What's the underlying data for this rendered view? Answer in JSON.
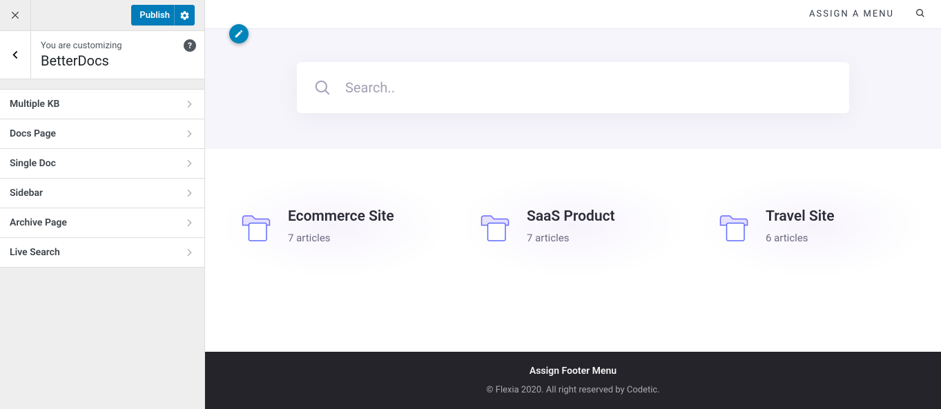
{
  "customizer": {
    "publish_label": "Publish",
    "pretitle": "You are customizing",
    "title": "BetterDocs",
    "help_symbol": "?",
    "items": [
      {
        "label": "Multiple KB"
      },
      {
        "label": "Docs Page"
      },
      {
        "label": "Single Doc"
      },
      {
        "label": "Sidebar"
      },
      {
        "label": "Archive Page"
      },
      {
        "label": "Live Search"
      }
    ]
  },
  "preview": {
    "header_menu": "ASSIGN A MENU",
    "search_placeholder": "Search..",
    "cards": [
      {
        "title": "Ecommerce Site",
        "subtitle": "7 articles"
      },
      {
        "title": "SaaS Product",
        "subtitle": "7 articles"
      },
      {
        "title": "Travel Site",
        "subtitle": "6 articles"
      }
    ],
    "footer_menu": "Assign Footer Menu",
    "copyright": "© Flexia 2020. All right reserved by Codetic."
  }
}
